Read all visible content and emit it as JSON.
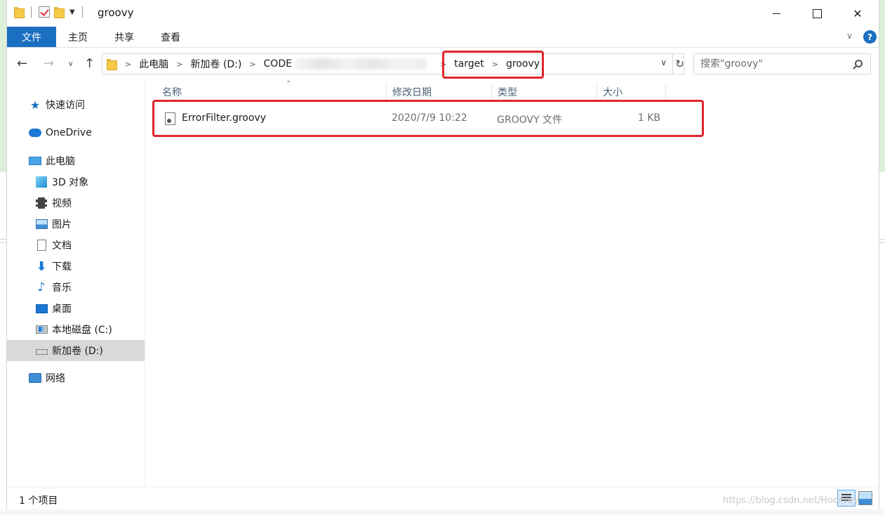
{
  "window": {
    "title": "groovy"
  },
  "ribbon": {
    "tabs": [
      "文件",
      "主页",
      "共享",
      "查看"
    ],
    "help": "?"
  },
  "address": {
    "crumbs": [
      "此电脑",
      "新加卷 (D:)",
      "CODE",
      "target",
      "groovy"
    ]
  },
  "search": {
    "placeholder": "搜索\"groovy\""
  },
  "sidebar": {
    "items": [
      {
        "label": "快速访问",
        "icon": "star-icon"
      },
      {
        "label": "OneDrive",
        "icon": "cloud-icon"
      },
      {
        "label": "此电脑",
        "icon": "computer-icon"
      },
      {
        "label": "3D 对象",
        "icon": "3d-objects-icon"
      },
      {
        "label": "视频",
        "icon": "video-icon"
      },
      {
        "label": "图片",
        "icon": "picture-icon"
      },
      {
        "label": "文档",
        "icon": "document-icon"
      },
      {
        "label": "下载",
        "icon": "download-icon"
      },
      {
        "label": "音乐",
        "icon": "music-icon"
      },
      {
        "label": "桌面",
        "icon": "desktop-icon"
      },
      {
        "label": "本地磁盘 (C:)",
        "icon": "drive-c-icon"
      },
      {
        "label": "新加卷 (D:)",
        "icon": "drive-d-icon"
      },
      {
        "label": "网络",
        "icon": "network-icon"
      }
    ],
    "selected": "新加卷 (D:)"
  },
  "columns": {
    "name": "名称",
    "date": "修改日期",
    "type": "类型",
    "size": "大小"
  },
  "files": [
    {
      "name": "ErrorFilter.groovy",
      "date": "2020/7/9 10:22",
      "type": "GROOVY 文件",
      "size": "1 KB"
    }
  ],
  "status": {
    "count": "1 个项目"
  },
  "watermark": "https://blog.csdn.net/Hoorvey",
  "colors": {
    "accent": "#1a6fc0",
    "highlight": "#e0262b",
    "selected": "#d9d9d9"
  }
}
